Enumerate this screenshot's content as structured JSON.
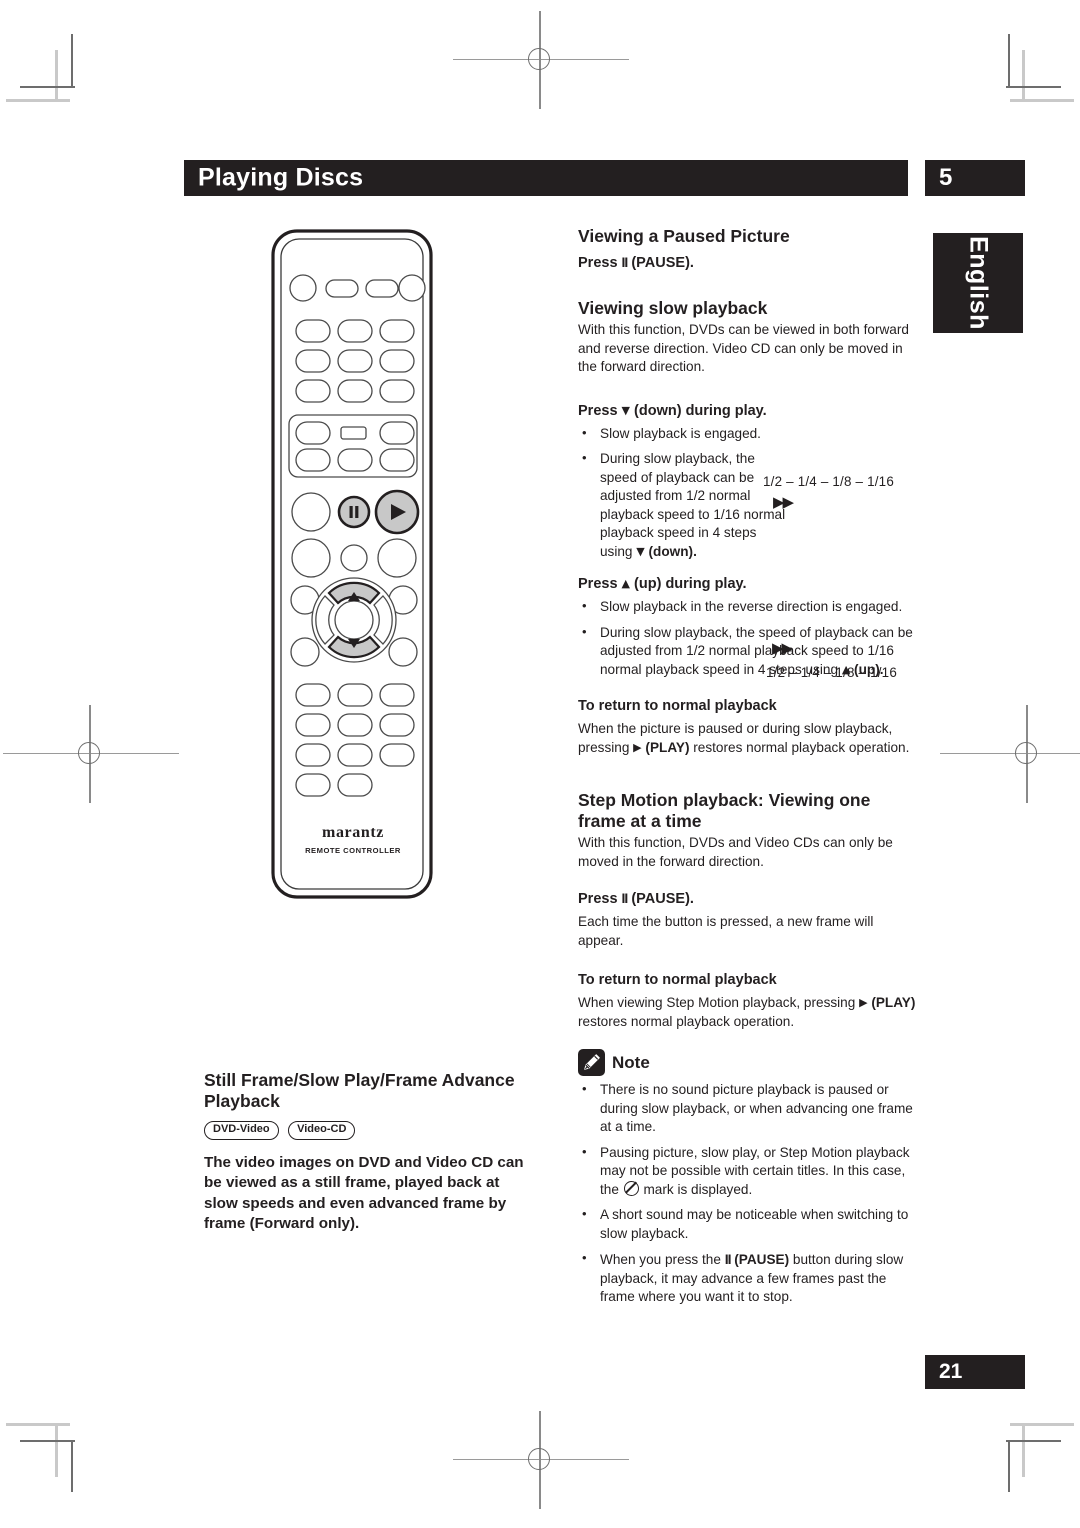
{
  "header": {
    "title": "Playing Discs",
    "chapter_number": "5",
    "language_tab": "English",
    "page_number": "21"
  },
  "left_column": {
    "section_title_line1": "Still Frame/Slow Play/Frame Advance",
    "section_title_line2": "Playback",
    "badges": [
      "DVD-Video",
      "Video-CD"
    ],
    "intro_paragraph": "The video images on DVD and Video CD can be viewed as a still frame, played back at slow speeds and even advanced frame by frame (Forward only).",
    "remote": {
      "brand": "marantz",
      "caption": "REMOTE CONTROLLER"
    }
  },
  "right_column": {
    "paused_picture": {
      "heading": "Viewing a Paused Picture",
      "instruction_prefix": "Press ",
      "instruction_glyph": "II",
      "instruction_suffix": " (PAUSE)."
    },
    "slow_playback": {
      "heading": "Viewing slow playback",
      "body": "With this function, DVDs can be viewed in both forward and reverse direction. Video CD can only be moved in the forward direction.",
      "down_heading_prefix": "Press ",
      "down_heading_glyph": "▼",
      "down_heading_suffix": " (down) during play.",
      "down_bullet_1": "Slow playback is engaged.",
      "down_bullet_2_a": "During slow playback, the speed of playback can be adjusted from 1/2 normal playback speed to 1/16 normal playback speed in 4 steps using ",
      "down_bullet_2_glyph": "▼",
      "down_bullet_2_b": " (down).",
      "down_speed_sequence": "1/2 – 1/4 – 1/8 –  1/16",
      "down_ff_arrows": "▶▶",
      "up_heading_prefix": "Press ",
      "up_heading_glyph": "▲",
      "up_heading_suffix": " (up) during play.",
      "up_bullet_1": "Slow playback in the reverse direction is engaged.",
      "up_bullet_2_a": "During slow playback, the speed of playback can be adjusted from 1/2 normal playback speed to 1/16 normal playback speed in 4 steps using ",
      "up_bullet_2_glyph": "▲",
      "up_bullet_2_b": " (up).",
      "up_speed_sequence": "1/2 – 1/4 –  1/8 – 1/16",
      "up_ff_arrows": "▶▶"
    },
    "return_normal_1": {
      "heading": "To return to normal playback",
      "body_a": "When the picture is paused or during slow playback, pressing ",
      "body_glyph": "▶",
      "body_b": " (PLAY)",
      "body_c": " restores normal playback operation."
    },
    "step_motion": {
      "heading_line1": "Step Motion playback: Viewing one",
      "heading_line2": "frame at a time",
      "body": "With this function, DVDs and Video CDs can only be moved in the forward direction.",
      "press_prefix": "Press ",
      "press_glyph": "II",
      "press_suffix": " (PAUSE).",
      "press_body": "Each time the button is pressed, a new frame will appear."
    },
    "return_normal_2": {
      "heading": "To return to normal playback",
      "body_a": "When viewing Step Motion playback, pressing ",
      "body_glyph": "▶",
      "body_b": " (PLAY)",
      "body_c": " restores normal playback operation."
    },
    "note": {
      "label": "Note",
      "icon": "pencil-icon",
      "bullets": [
        {
          "text": "There is no sound picture playback is paused or during slow playback, or when advancing one frame at a time."
        },
        {
          "text_a": "Pausing picture, slow play, or Step Motion playback may not be possible with certain titles. In this case, the ",
          "mark": "prohibition-mark",
          "text_b": " mark is displayed."
        },
        {
          "text": "A short sound may be noticeable when switching to slow playback."
        },
        {
          "text_a": "When you press the ",
          "glyph": "II",
          "text_b": " (PAUSE)",
          "text_c": " button during slow playback, it may advance a few frames past the frame where you want it to stop."
        }
      ]
    }
  },
  "colors": {
    "ink": "#231f20",
    "paper": "#ffffff",
    "crop_mark": "#6d6d6d",
    "button_fill": "#c8c8c8"
  }
}
